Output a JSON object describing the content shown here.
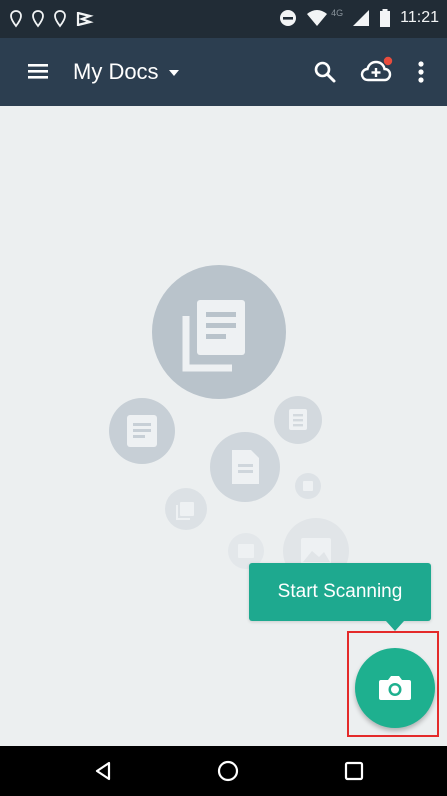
{
  "status_bar": {
    "time": "11:21",
    "network": "4G",
    "icons": [
      "location-pin-icon",
      "location-pin-icon",
      "location-pin-icon",
      "flag-icon",
      "do-not-disturb-icon",
      "wifi-icon",
      "signal-icon",
      "battery-icon"
    ]
  },
  "appbar": {
    "title": "My Docs",
    "icons": [
      "menu-icon",
      "caret-down-icon",
      "search-icon",
      "cloud-upload-icon",
      "more-vert-icon"
    ],
    "colors": {
      "background": "#2c3e50",
      "notification_dot": "#e84c3d"
    }
  },
  "empty_state": {
    "icons": [
      "documents-stack-icon",
      "document-icon",
      "file-icon",
      "image-icon"
    ]
  },
  "tooltip": {
    "text": "Start Scanning"
  },
  "fab": {
    "icon": "camera-icon",
    "color": "#1eb08f"
  },
  "system_nav": {
    "icons": [
      "back-icon",
      "home-icon",
      "recents-icon"
    ]
  }
}
